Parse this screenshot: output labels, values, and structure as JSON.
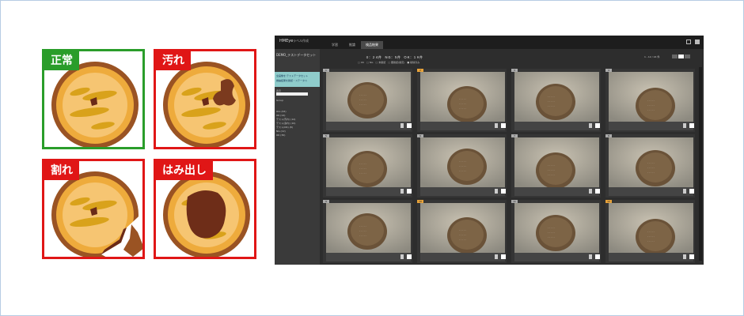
{
  "categories": [
    {
      "label": "正常",
      "type": "ok"
    },
    {
      "label": "汚れ",
      "type": "ng"
    },
    {
      "label": "割れ",
      "type": "ng"
    },
    {
      "label": "はみ出し",
      "type": "ng"
    }
  ],
  "app": {
    "brand": "HMEye",
    "menu": "ラベル作成",
    "tabs": [
      "学習",
      "推論",
      "検品結果"
    ],
    "active_tab": "検品結果",
    "sidebar": {
      "title": "DEMO_テストデータセット",
      "highlight_line1": "全画像を:テストデータセット",
      "highlight_line2": "推論結果を確認・ステータス",
      "filter_label": "表示",
      "group_label": "Group",
      "items": [
        "ALL (44)",
        "OK (14)",
        "テスト(汚れ) (12)",
        "テスト(割れ) (10)",
        "テスト(OK) (8)",
        "NG (12)",
        "OK (30)"
      ]
    },
    "stats": "０：２４件　ＮＧ：５件　ＯＫ：１９件",
    "substats": "□ OK　□ NG　□ 未確認　□ 要確認(確定)　■ 削除済み",
    "pager": "1 - 12 / 24 件",
    "cell_numbers": [
      "1",
      "2",
      "3",
      "4",
      "5",
      "6",
      "7",
      "8",
      "9",
      "10",
      "11",
      "12"
    ],
    "pending_cells": [
      1,
      9,
      11
    ]
  },
  "colors": {
    "ok": "#2a9d2a",
    "ng": "#e01616",
    "pending": "#e8a33a",
    "highlight": "#8fcccb"
  }
}
